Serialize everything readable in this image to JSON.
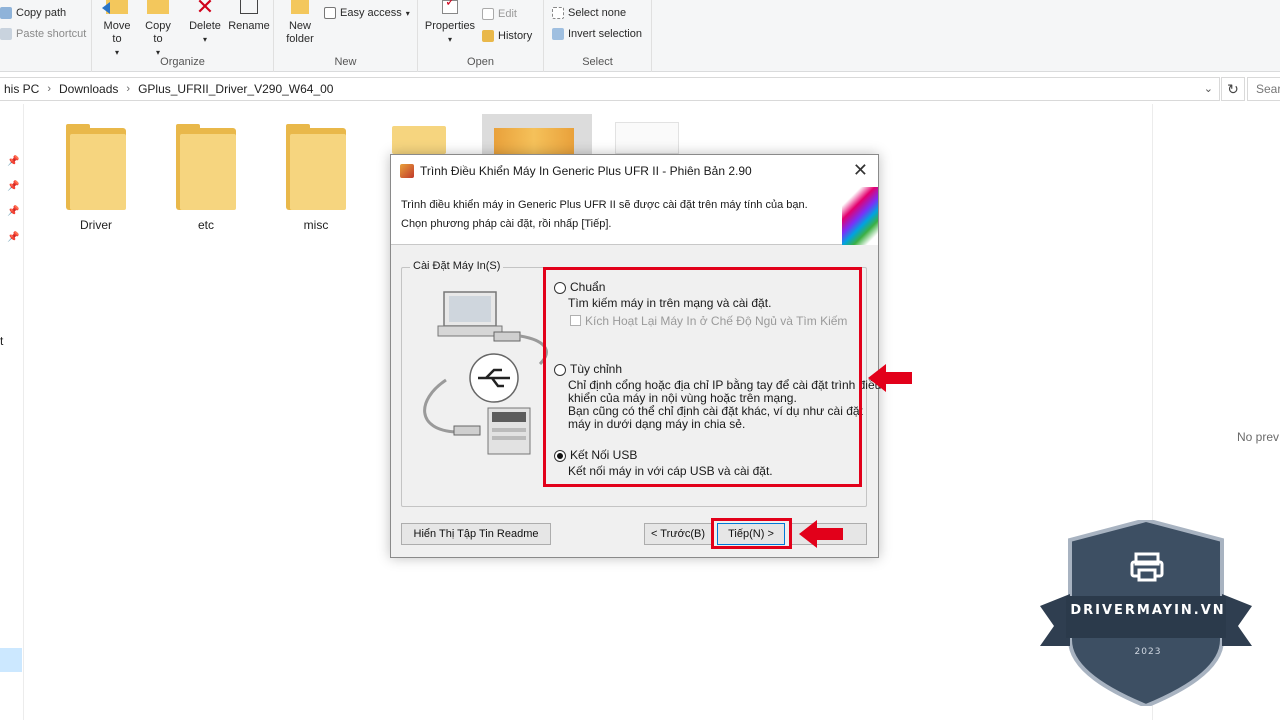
{
  "ribbon": {
    "clipboard": {
      "copy_path": "Copy path",
      "paste_shortcut": "Paste shortcut"
    },
    "organize": {
      "label": "Organize",
      "move_to": "Move to",
      "copy_to": "Copy to",
      "delete": "Delete",
      "rename": "Rename"
    },
    "new": {
      "label": "New",
      "new_folder": "New folder",
      "easy_access": "Easy access"
    },
    "open": {
      "label": "Open",
      "properties": "Properties",
      "edit": "Edit",
      "history": "History"
    },
    "select": {
      "label": "Select",
      "select_none": "Select none",
      "invert_selection": "Invert selection"
    }
  },
  "address": {
    "crumbs": [
      "his PC",
      "Downloads",
      "GPlus_UFRII_Driver_V290_W64_00"
    ],
    "search_placeholder": "Sear"
  },
  "nav": {
    "partial_label": "t"
  },
  "folders": [
    {
      "name": "Driver"
    },
    {
      "name": "etc"
    },
    {
      "name": "misc"
    }
  ],
  "preview": {
    "text": "No prev"
  },
  "dialog": {
    "title": "Trình Điều Khiển Máy In Generic Plus UFR II - Phiên Bản 2.90",
    "intro_line1": "Trình điều khiển máy in Generic Plus UFR II sẽ được cài đặt trên máy tính của bạn.",
    "intro_line2": "Chọn phương pháp cài đặt, rồi nhấp [Tiếp].",
    "group_label": "Cài Đặt Máy In(S)",
    "options": {
      "standard": {
        "label": "Chuẩn",
        "desc": "Tìm kiếm máy in trên mạng và cài đặt.",
        "checkbox_label": "Kích Hoạt Lại Máy In ở Chế Độ Ngủ và Tìm Kiếm",
        "checked": false
      },
      "custom": {
        "label": "Tùy chỉnh",
        "desc_line1": "Chỉ định cổng hoặc địa chỉ IP bằng tay để cài đặt trình điều",
        "desc_line2": "khiển của máy in nội vùng hoặc trên mạng.",
        "desc_line3": "Bạn cũng có thể chỉ định cài đặt khác, ví dụ như cài đặt",
        "desc_line4": "máy in dưới dạng máy in chia sẻ.",
        "checked": false
      },
      "usb": {
        "label": "Kết Nối USB",
        "desc": "Kết nối máy in với cáp USB và cài đặt.",
        "checked": true
      }
    },
    "buttons": {
      "readme": "Hiển Thị Tập Tin Readme",
      "back": "< Trước(B)",
      "next": "Tiếp(N) >"
    }
  },
  "watermark": {
    "brand": "DRIVERMAYIN.VN",
    "year": "2023"
  },
  "colors": {
    "highlight_red": "#e2001a",
    "folder_yellow": "#f6d57f",
    "badge_navy": "#3d4f63"
  }
}
